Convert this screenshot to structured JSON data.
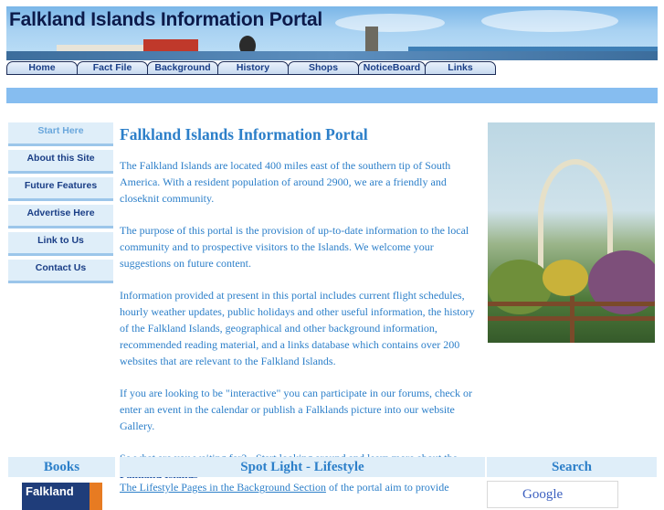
{
  "header": {
    "title": "Falkland Islands Information Portal"
  },
  "nav": {
    "tabs": [
      {
        "label": "Home"
      },
      {
        "label": "Fact File"
      },
      {
        "label": "Background"
      },
      {
        "label": "History"
      },
      {
        "label": "Shops"
      },
      {
        "label": "NoticeBoard"
      },
      {
        "label": "Links"
      }
    ]
  },
  "sidebar": {
    "items": [
      {
        "label": "Start Here"
      },
      {
        "label": "About this Site"
      },
      {
        "label": "Future Features"
      },
      {
        "label": "Advertise Here"
      },
      {
        "label": "Link to Us"
      },
      {
        "label": "Contact Us"
      }
    ]
  },
  "main": {
    "title": "Falkland Islands Information Portal",
    "p1": "The Falkland Islands are located 400 miles east of the southern tip of South America.  With a resident  population of around 2900, we are a friendly and closeknit community.",
    "p2": "The purpose of this portal is the provision of up-to-date information to the local community and to prospective visitors to the Islands.  We welcome your suggestions on future content.",
    "p3": "Information provided at present in this portal includes current flight schedules, hourly weather updates, public holidays and other useful information, the history of the Falkland Islands, geographical and other background information, recommended reading material, and a links database which contains over 200 websites that are relevant to the Falkland Islands.",
    "p4": "If you are looking to be \"interactive\" you can participate in our forums, check or enter an event in the calendar or publish a Falklands picture into our website Gallery.",
    "p5_text": "So what are you waiting for? - Start looking around and  learn more about the ",
    "p5_bold": "Falkland Islands"
  },
  "bottom": {
    "books_title": "Books",
    "book_cover_text": "Falkland",
    "spotlight_title": "Spot Light - Lifestyle",
    "spotlight_link": "The Lifestyle Pages in the Background Section",
    "spotlight_rest": " of the portal aim to provide",
    "search_title": "Search",
    "search_logo": "Google"
  },
  "colors": {
    "link_blue": "#2c7fc9",
    "nav_text": "#1a3e86",
    "sidebar_bg": "#dfeef9",
    "bar_blue": "#86bdf0"
  }
}
